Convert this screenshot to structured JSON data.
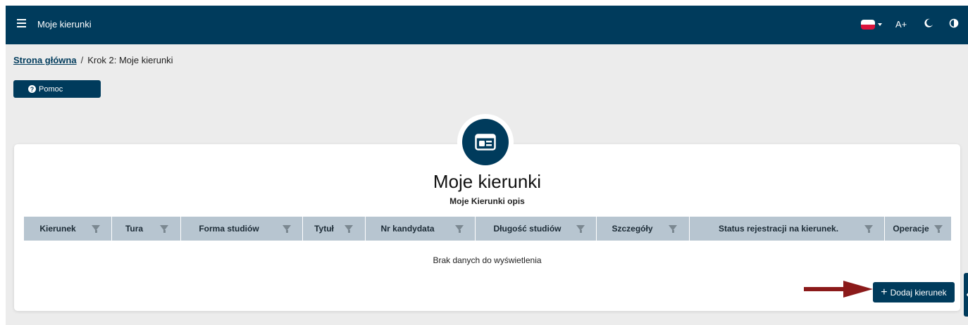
{
  "header": {
    "title": "Moje kierunki",
    "font_size_label": "A+"
  },
  "breadcrumb": {
    "home": "Strona główna",
    "separator": "/",
    "current": "Krok 2: Moje kierunki"
  },
  "help_button": {
    "label": "Pomoc",
    "icon_glyph": "?"
  },
  "card": {
    "title": "Moje kierunki",
    "subtitle": "Moje Kierunki opis",
    "columns": [
      "Kierunek",
      "Tura",
      "Forma studiów",
      "Tytuł",
      "Nr kandydata",
      "Długość studiów",
      "Szczegóły",
      "Status rejestracji na kierunek.",
      "Operacje"
    ],
    "empty_message": "Brak danych do wyświetlenia",
    "add_button_label": "Dodaj kierunek",
    "add_button_icon": "+"
  },
  "colors": {
    "primary": "#003b5c",
    "table_header": "#b7c5d0",
    "arrow": "#8b1a1a",
    "flag_red": "#dc143c"
  },
  "icons": [
    "menu-icon",
    "poland-flag-icon",
    "moon-icon",
    "contrast-icon",
    "help-icon",
    "id-card-icon",
    "filter-icon",
    "plus-icon",
    "chevron-left-icon"
  ]
}
